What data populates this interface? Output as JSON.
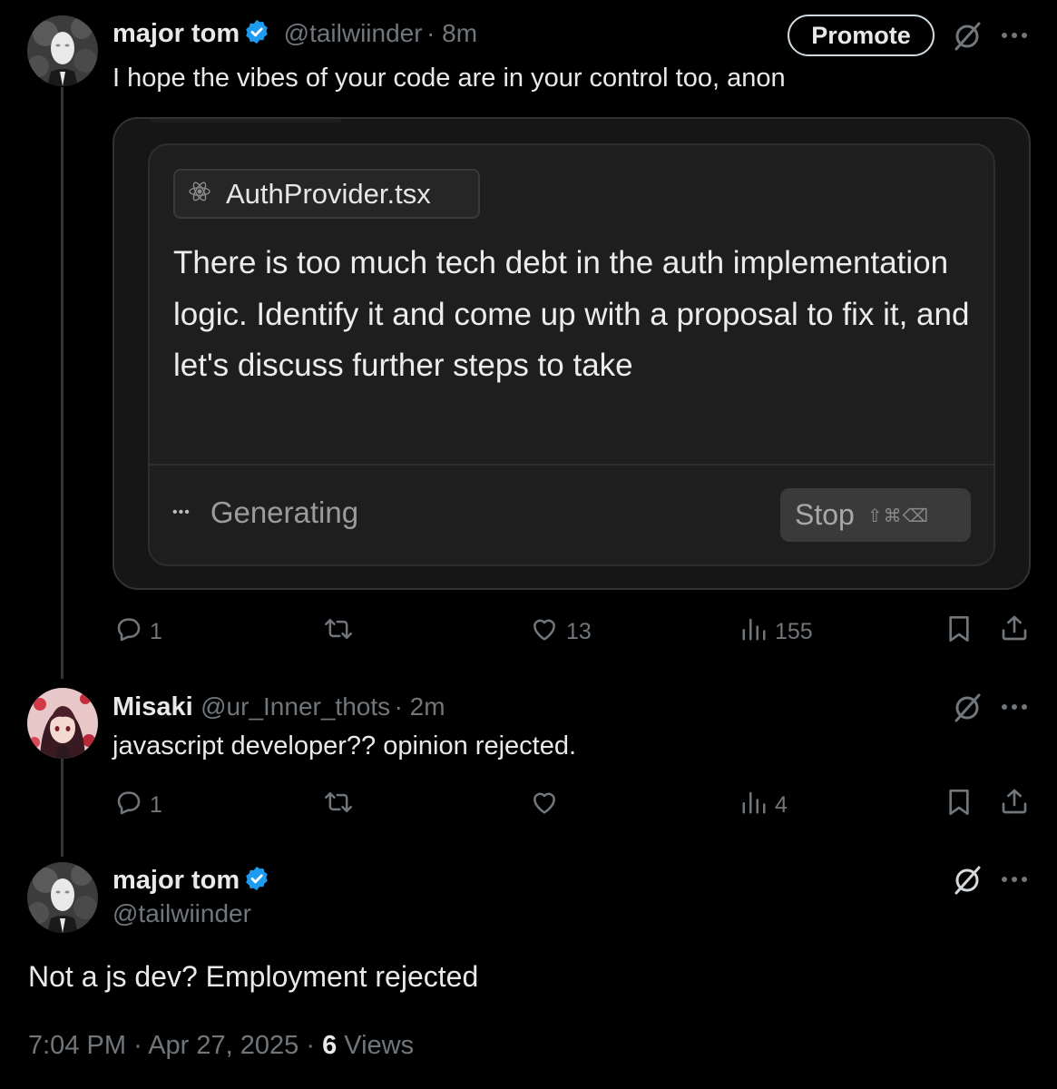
{
  "colors": {
    "background": "#000000",
    "text": "#e7e9ea",
    "muted": "#71767b",
    "verified": "#1d9bf0"
  },
  "post1": {
    "name": "major tom",
    "handle": "@tailwiinder",
    "time": "· 8m",
    "promote_label": "Promote",
    "text": "I hope the vibes of your code are in your control too, anon",
    "embed": {
      "file_name": "AuthProvider.tsx",
      "prompt": "There is too much tech debt in the auth implementation logic. Identify it and come up with a proposal to fix it, and let's discuss further steps to take",
      "status": "Generating",
      "dots": "•••",
      "stop_label": "Stop",
      "stop_shortcut": "⇧⌘⌫"
    },
    "replies": "1",
    "likes": "13",
    "views": "155"
  },
  "post2": {
    "name": "Misaki",
    "handle": "@ur_Inner_thots",
    "time": "· 2m",
    "text": "javascript developer?? opinion rejected.",
    "replies": "1",
    "views": "4"
  },
  "post3": {
    "name": "major tom",
    "handle": "@tailwiinder",
    "text": "Not a js dev? Employment rejected",
    "time": "7:04 PM",
    "date": "Apr 27, 2025",
    "separator": "·",
    "views_count": "6",
    "views_label": "Views"
  }
}
